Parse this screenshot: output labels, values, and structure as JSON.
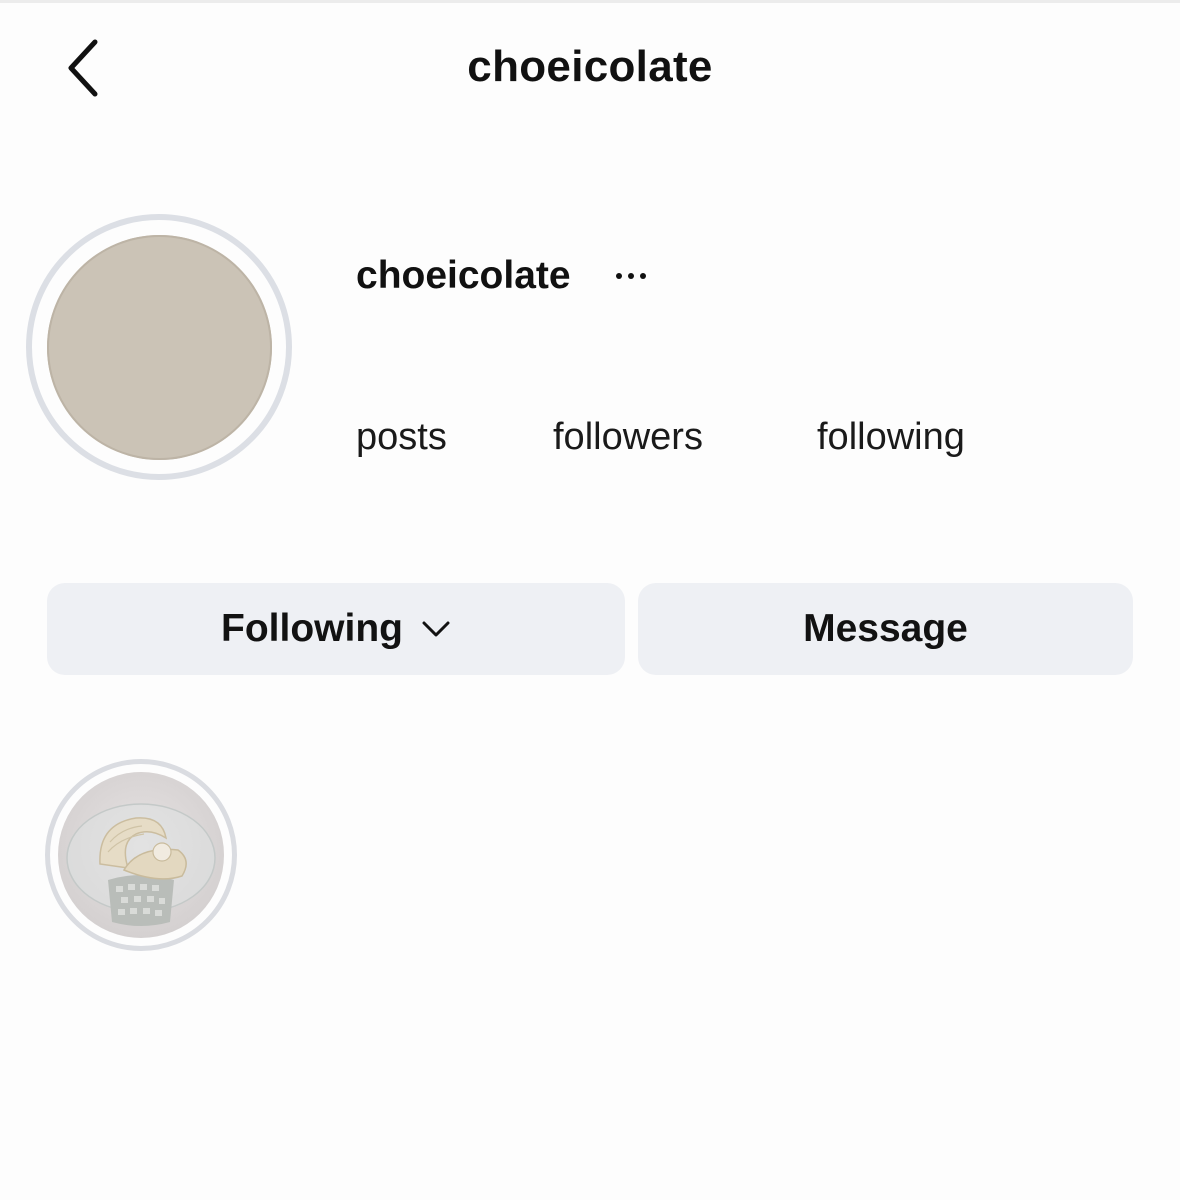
{
  "header": {
    "title": "choeicolate",
    "back_icon": "chevron-left-icon"
  },
  "profile": {
    "username": "choeicolate",
    "more_icon": "ellipsis-icon",
    "avatar_color": "#cbc3b6",
    "stats": {
      "posts_label": "posts",
      "followers_label": "followers",
      "following_label": "following"
    }
  },
  "actions": {
    "following_label": "Following",
    "following_icon": "chevron-down-icon",
    "message_label": "Message"
  },
  "highlights": [
    {
      "image": "shell-bowl-on-glass-table"
    }
  ],
  "colors": {
    "button_bg": "#eef0f4",
    "ring": "#dcdfe5"
  }
}
